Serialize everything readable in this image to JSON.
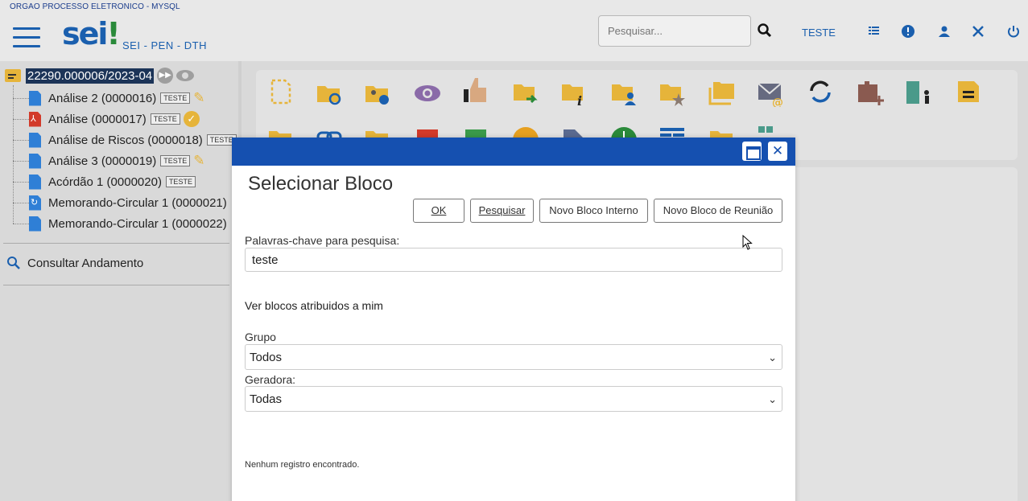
{
  "header": {
    "org_title": "ORGAO PROCESSO ELETRONICO - MYSQL",
    "logo_main": "sei",
    "logo_bang": "!",
    "logo_sub": "SEI - PEN - DTH",
    "search_placeholder": "Pesquisar...",
    "user_name": "TESTE",
    "icons": [
      "menu-icon",
      "search-icon",
      "list-icon",
      "alert-icon",
      "user-icon",
      "tools-icon",
      "power-icon"
    ]
  },
  "tree": {
    "process_number": "22290.000006/2023-04",
    "documents": [
      {
        "label": "Análise 2 (0000016)",
        "tag": "TESTE",
        "icon": "document-icon",
        "extra": "pencil-icon"
      },
      {
        "label": "Análise (0000017)",
        "tag": "TESTE",
        "icon": "pdf-icon",
        "extra": "signed-badge-icon"
      },
      {
        "label": "Análise de Riscos (0000018)",
        "tag": "TESTE",
        "icon": "document-icon",
        "extra": ""
      },
      {
        "label": "Análise 3 (0000019)",
        "tag": "TESTE",
        "icon": "document-icon",
        "extra": "pencil-icon"
      },
      {
        "label": "Acórdão 1 (0000020)",
        "tag": "TESTE",
        "icon": "document-icon",
        "extra": ""
      },
      {
        "label": "Memorando-Circular 1 (0000021)",
        "tag": "",
        "icon": "circular-document-icon",
        "extra": ""
      },
      {
        "label": "Memorando-Circular 1 (0000022)",
        "tag": "",
        "icon": "document-icon",
        "extra": ""
      }
    ],
    "consult_label": "Consultar Andamento"
  },
  "modal": {
    "title": "Selecionar Bloco",
    "buttons": {
      "ok": "OK",
      "pesquisar": "Pesquisar",
      "novo_interno": "Novo Bloco Interno",
      "novo_reuniao": "Novo Bloco de Reunião"
    },
    "keywords_label": "Palavras-chave para pesquisa:",
    "keywords_value": "teste",
    "assigned_label": "Ver blocos atribuidos a mim",
    "grupo_label": "Grupo",
    "grupo_value": "Todos",
    "geradora_label": "Geradora:",
    "geradora_value": "Todas",
    "empty_message": "Nenhum registro encontrado."
  },
  "colors": {
    "accent_blue": "#1550b0",
    "folder_yellow": "#e6b43a",
    "doc_blue": "#2f7fd6",
    "pdf_red": "#d23a2a"
  }
}
